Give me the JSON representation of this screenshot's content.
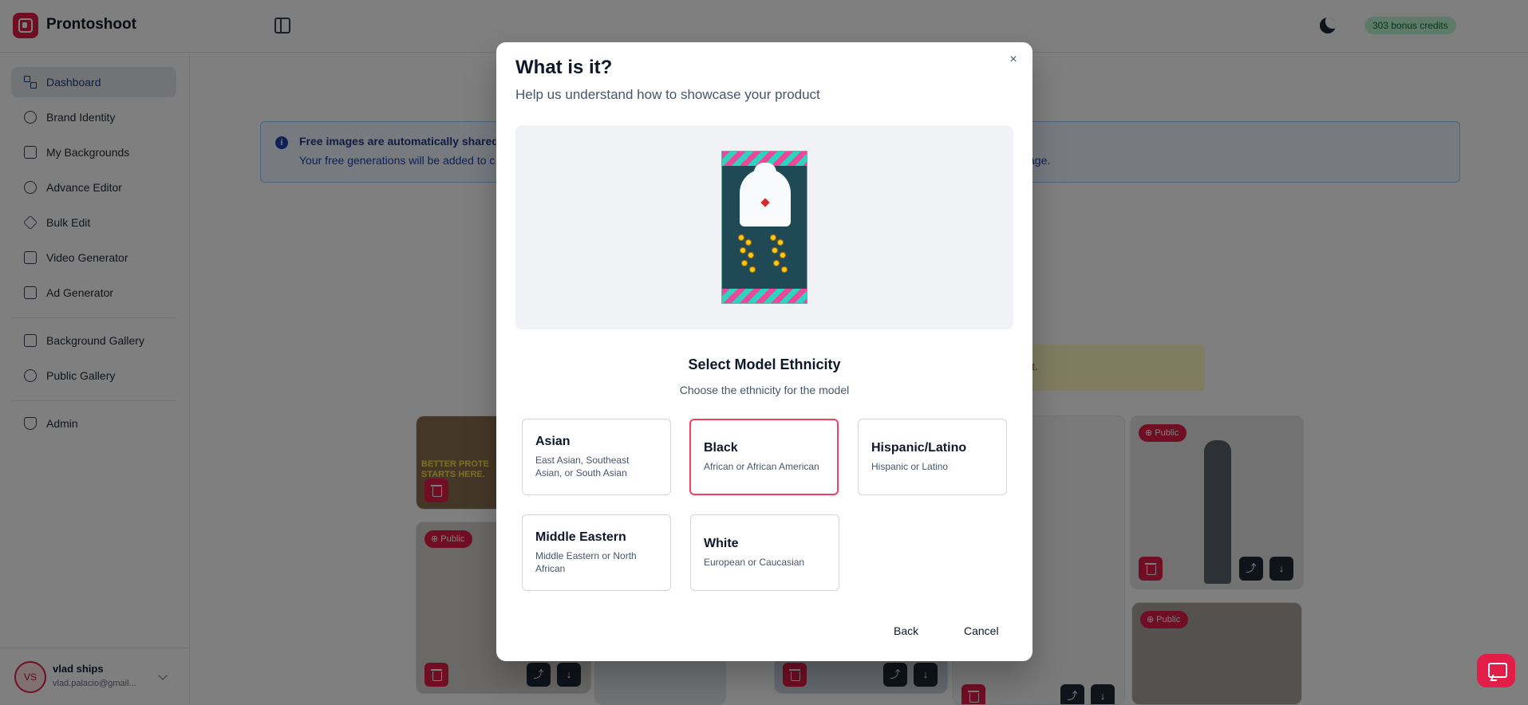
{
  "app": {
    "name": "Prontoshoot",
    "credits": "303 bonus credits"
  },
  "sidebar": {
    "items": [
      {
        "label": "Dashboard"
      },
      {
        "label": "Brand Identity"
      },
      {
        "label": "My Backgrounds"
      },
      {
        "label": "Advance Editor"
      },
      {
        "label": "Bulk Edit"
      },
      {
        "label": "Video Generator"
      },
      {
        "label": "Ad Generator"
      },
      {
        "label": "Background Gallery"
      },
      {
        "label": "Public Gallery"
      },
      {
        "label": "Admin"
      }
    ],
    "user": {
      "initials": "VS",
      "name": "vlad ships",
      "email": "vlad.palacio@gmail..."
    }
  },
  "background": {
    "info_title": "Free images are automatically shared t",
    "info_text": "Your free generations will be added to c",
    "info_text_tail": "age.",
    "yellow_text": "nt.",
    "public_label": "Public",
    "card_text": "BETTER PROTE STARTS HERE."
  },
  "modal": {
    "title": "What is it?",
    "subtitle": "Help us understand how to showcase your product",
    "close": "×",
    "section_title": "Select Model Ethnicity",
    "section_subtitle": "Choose the ethnicity for the model",
    "options": [
      {
        "title": "Asian",
        "desc": "East Asian, Southeast Asian, or South Asian",
        "selected": false
      },
      {
        "title": "Black",
        "desc": "African or African American",
        "selected": true
      },
      {
        "title": "Hispanic/Latino",
        "desc": "Hispanic or Latino",
        "selected": false
      },
      {
        "title": "Middle Eastern",
        "desc": "Middle Eastern or North African",
        "selected": false
      },
      {
        "title": "White",
        "desc": "European or Caucasian",
        "selected": false
      }
    ],
    "back_label": "Back",
    "cancel_label": "Cancel"
  },
  "colors": {
    "accent": "#e11d48",
    "selected_border": "#f43f5e",
    "credits_bg": "#bbf7d0"
  }
}
